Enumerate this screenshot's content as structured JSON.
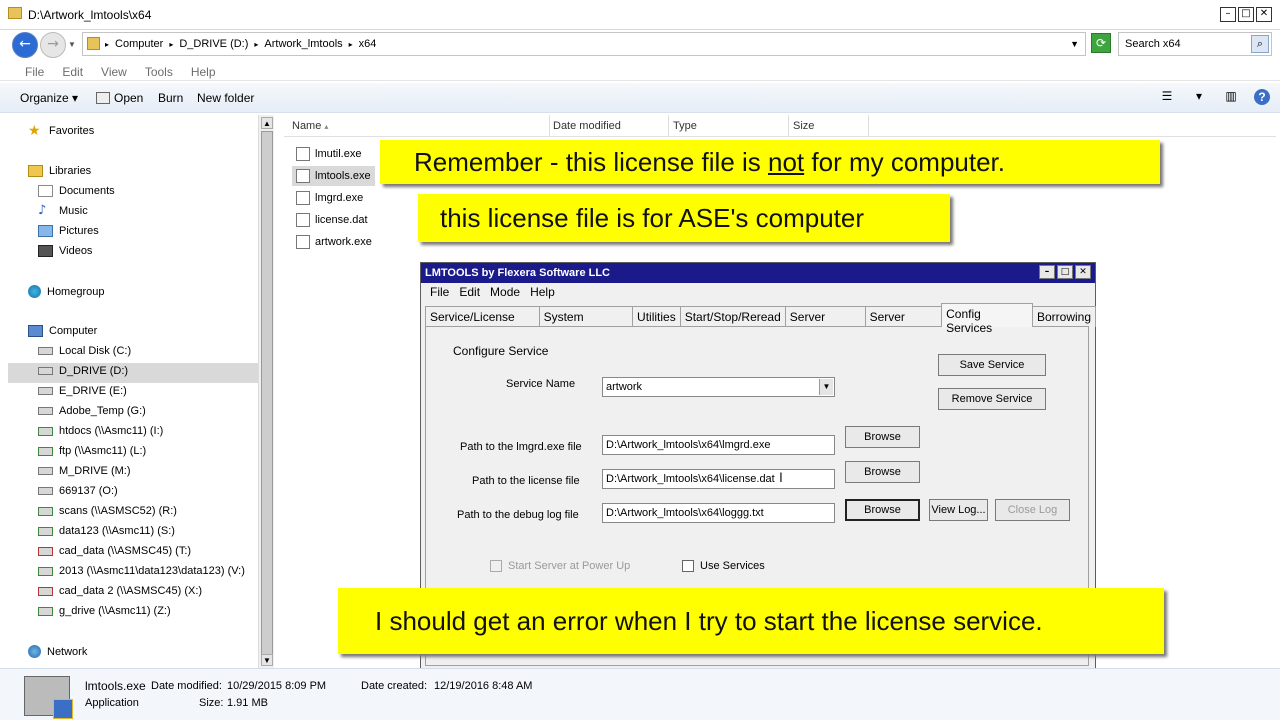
{
  "window": {
    "title": "D:\\Artwork_lmtools\\x64"
  },
  "address": {
    "crumbs": [
      "Computer",
      "D_DRIVE (D:)",
      "Artwork_lmtools",
      "x64"
    ],
    "search_placeholder": "Search x64"
  },
  "menu": [
    "File",
    "Edit",
    "View",
    "Tools",
    "Help"
  ],
  "toolbar": {
    "organize": "Organize",
    "open": "Open",
    "burn": "Burn",
    "new_folder": "New folder"
  },
  "nav": {
    "favorites": "Favorites",
    "libraries": "Libraries",
    "library_items": [
      "Documents",
      "Music",
      "Pictures",
      "Videos"
    ],
    "homegroup": "Homegroup",
    "computer": "Computer",
    "drives": [
      "Local Disk (C:)",
      "D_DRIVE (D:)",
      "E_DRIVE (E:)",
      "Adobe_Temp (G:)",
      "htdocs (\\\\Asmc11) (I:)",
      "ftp (\\\\Asmc11) (L:)",
      "M_DRIVE (M:)",
      "669137 (O:)",
      "scans (\\\\ASMSC52) (R:)",
      "data123 (\\\\Asmc11) (S:)",
      "cad_data (\\\\ASMSC45) (T:)",
      "2013 (\\\\Asmc11\\data123\\data123) (V:)",
      "cad_data 2 (\\\\ASMSC45) (X:)",
      "g_drive (\\\\Asmc11) (Z:)"
    ],
    "network": "Network"
  },
  "columns": [
    "Name",
    "Date modified",
    "Type",
    "Size"
  ],
  "files": [
    "lmutil.exe",
    "lmtools.exe",
    "lmgrd.exe",
    "license.dat",
    "artwork.exe"
  ],
  "callouts": {
    "c1_pre": "Remember - this license file is ",
    "c1_not": "not",
    "c1_post": " for my computer.",
    "c2": "this license file is for ASE's computer",
    "c3": "I should get an error when I try to start the license service."
  },
  "lmtools": {
    "title": "LMTOOLS by Flexera Software LLC",
    "menu": [
      "File",
      "Edit",
      "Mode",
      "Help"
    ],
    "tabs": [
      "Service/License File",
      "System Settings",
      "Utilities",
      "Start/Stop/Reread",
      "Server Status",
      "Server Diags",
      "Config Services",
      "Borrowing"
    ],
    "configure_service": "Configure Service",
    "service_name_label": "Service Name",
    "service_name": "artwork",
    "lmgrd_label": "Path to the lmgrd.exe file",
    "lmgrd_path": "D:\\Artwork_lmtools\\x64\\lmgrd.exe",
    "license_label": "Path to the license file",
    "license_path": "D:\\Artwork_lmtools\\x64\\license.dat",
    "debug_label": "Path to the debug log file",
    "debug_path": "D:\\Artwork_lmtools\\x64\\loggg.txt",
    "save_service": "Save Service",
    "remove_service": "Remove Service",
    "browse": "Browse",
    "view_log": "View Log...",
    "close_log": "Close Log",
    "start_server": "Start Server at Power Up",
    "use_services": "Use Services"
  },
  "details": {
    "name": "lmtools.exe",
    "type": "Application",
    "date_modified_label": "Date modified:",
    "date_modified": "10/29/2015 8:09 PM",
    "size_label": "Size:",
    "size": "1.91 MB",
    "date_created_label": "Date created:",
    "date_created": "12/19/2016 8:48 AM"
  }
}
